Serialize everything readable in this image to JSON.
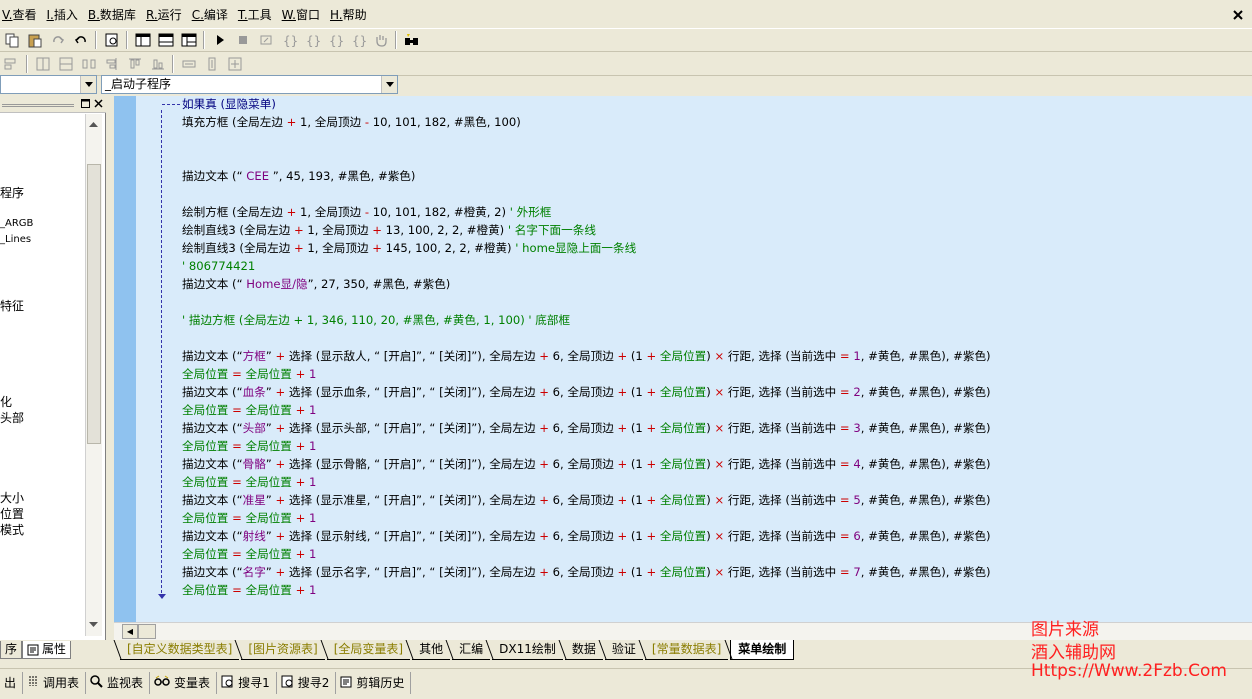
{
  "menu": [
    {
      "key": "V.",
      "label": "查看"
    },
    {
      "key": "I.",
      "label": "插入"
    },
    {
      "key": "B.",
      "label": "数据库"
    },
    {
      "key": "R.",
      "label": "运行"
    },
    {
      "key": "C.",
      "label": "编译"
    },
    {
      "key": "T.",
      "label": "工具"
    },
    {
      "key": "W.",
      "label": "窗口"
    },
    {
      "key": "H.",
      "label": "帮助"
    }
  ],
  "combo": {
    "left_value": "",
    "right_value": "_启动子程序"
  },
  "left_panel": {
    "lines": [
      "程序",
      "_ARGB",
      "_Lines",
      "特征",
      "化",
      "头部",
      "大小",
      "位置",
      "模式"
    ],
    "tabs": [
      "序",
      "属性"
    ]
  },
  "code": {
    "header": "如果真 (显隐菜单)",
    "l1": [
      "填充方框 (全局左边 ",
      "+",
      " 1, 全局顶边 ",
      "-",
      " 10, 101, 182, #黑色, 100)"
    ],
    "l2": [
      "描边文本 (“",
      " CEE   ",
      "”, 45, 193, #黑色, #紫色)"
    ],
    "l3": [
      "绘制方框 (全局左边 ",
      "+",
      " 1, 全局顶边 ",
      "-",
      " 10, 101, 182, #橙黄, 2) ",
      "' 外形框"
    ],
    "l4": [
      "绘制直线3 (全局左边 ",
      "+",
      " 1, 全局顶边 ",
      "+",
      " 13, 100, 2, 2, #橙黄) ",
      "' 名字下面一条线"
    ],
    "l5": [
      "绘制直线3 (全局左边 ",
      "+",
      " 1, 全局顶边 ",
      "+",
      " 145, 100, 2, 2, #橙黄) ",
      "' home显隐上面一条线"
    ],
    "l6": "' 806774421",
    "l7": [
      "描边文本 (“",
      " Home显/隐",
      "”, 27, 350, #黑色, #紫色)"
    ],
    "l8": "' 描边方框 (全局左边 + 1, 346, 110, 20, #黑色, #黄色, 1, 100) ' 底部框",
    "items": [
      {
        "name": "方框",
        "show": "显示敌人",
        "idx": "1"
      },
      {
        "name": "血条",
        "show": "显示血条",
        "idx": "2"
      },
      {
        "name": "头部",
        "show": "显示头部",
        "idx": "3"
      },
      {
        "name": "骨骼",
        "show": "显示骨骼",
        "idx": "4"
      },
      {
        "name": "准星",
        "show": "显示准星",
        "idx": "5"
      },
      {
        "name": "射线",
        "show": "显示射线",
        "idx": "6"
      },
      {
        "name": "名字",
        "show": "显示名字",
        "idx": "7"
      }
    ],
    "tpl": {
      "a": "描边文本 (“",
      "b": "” ",
      "c": " 选择 (",
      "d": ", “  [开启]”, “  [关闭]”), 全局左边 ",
      "e": " 6, 全局顶边 ",
      "f": " (1 ",
      "g": "全局位置",
      "h": ") ",
      "i": " 行距, 选择 (当前选中 ",
      "j": " ",
      "k": ", #黄色, #黑色), #紫色)",
      "plus": "+",
      "times": "×",
      "eq": "=",
      "inc_a": "全局位置",
      "inc_b": "全局位置",
      "inc_c": " 1"
    }
  },
  "sheet_tabs": [
    {
      "label": "[自定义数据类型表]",
      "style": "y"
    },
    {
      "label": "[图片资源表]",
      "style": "y"
    },
    {
      "label": "[全局变量表]",
      "style": "y"
    },
    {
      "label": "其他",
      "style": ""
    },
    {
      "label": "汇编",
      "style": ""
    },
    {
      "label": "DX11绘制",
      "style": ""
    },
    {
      "label": "数据",
      "style": ""
    },
    {
      "label": "验证",
      "style": ""
    },
    {
      "label": "[常量数据表]",
      "style": "y"
    },
    {
      "label": "菜单绘制",
      "style": "active"
    }
  ],
  "output_tabs": [
    "出",
    "调用表",
    "监视表",
    "变量表",
    "搜寻1",
    "搜寻2",
    "剪辑历史"
  ],
  "watermark": {
    "line1": "图片来源",
    "line2": "酒入辅助网",
    "line3": "Https://Www.2Fzb.Com"
  }
}
